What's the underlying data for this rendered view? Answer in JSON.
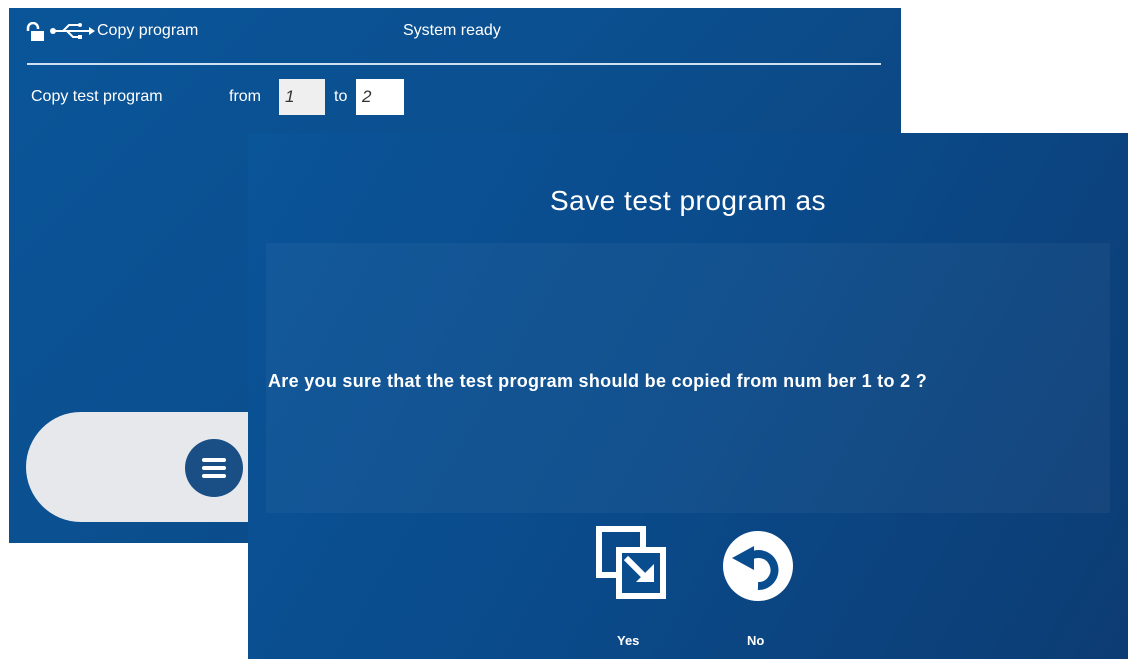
{
  "window": {
    "title": "Copy program",
    "status": "System ready"
  },
  "copy_row": {
    "label": "Copy test program",
    "from_label": "from",
    "from_value": "1",
    "to_label": "to",
    "to_value": "2"
  },
  "dialog": {
    "title": "Save test program as",
    "message": "Are you sure that the test program should be copied from num ber 1 to 2 ?",
    "yes_label": "Yes",
    "no_label": "No"
  },
  "icons": {
    "lock": "unlock-icon",
    "usb": "usb-icon",
    "menu": "menu-icon",
    "yes": "copy-icon",
    "no": "undo-icon"
  },
  "colors": {
    "background_blue": "#0b4f8f",
    "menu_button": "#1a4f86",
    "pill": "#e6e8ec"
  }
}
